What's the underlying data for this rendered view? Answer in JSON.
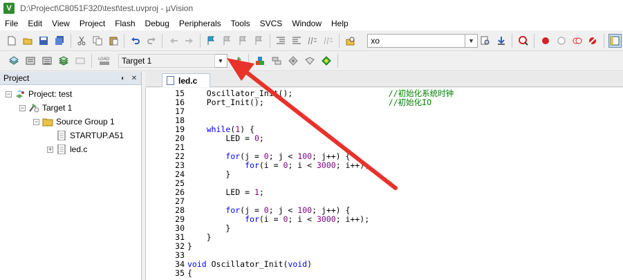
{
  "window": {
    "title": "D:\\Project\\C8051F320\\test\\test.uvproj - µVision",
    "icon_letter": "V"
  },
  "menu": [
    "File",
    "Edit",
    "View",
    "Project",
    "Flash",
    "Debug",
    "Peripherals",
    "Tools",
    "SVCS",
    "Window",
    "Help"
  ],
  "toolbar1": {
    "search_value": "xo"
  },
  "toolbar2": {
    "target_value": "Target 1"
  },
  "project_panel": {
    "title": "Project",
    "tree": [
      {
        "label": "Project: test",
        "expander": "−"
      },
      {
        "label": "Target 1",
        "expander": "−"
      },
      {
        "label": "Source Group 1",
        "expander": "−"
      },
      {
        "label": "STARTUP.A51",
        "expander": ""
      },
      {
        "label": "led.c",
        "expander": "+"
      }
    ]
  },
  "editor": {
    "tab_label": "led.c",
    "lines": [
      {
        "n": "15",
        "t": "    Oscillator_Init();                    //初始化系统时钟"
      },
      {
        "n": "16",
        "t": "    Port_Init();                          //初始化IO"
      },
      {
        "n": "17",
        "t": ""
      },
      {
        "n": "18",
        "t": ""
      },
      {
        "n": "19",
        "t": "    while(1) {"
      },
      {
        "n": "20",
        "t": "        LED = 0;"
      },
      {
        "n": "21",
        "t": ""
      },
      {
        "n": "22",
        "t": "        for(j = 0; j < 100; j++) {"
      },
      {
        "n": "23",
        "t": "            for(i = 0; i < 3000; i++);"
      },
      {
        "n": "24",
        "t": "        }"
      },
      {
        "n": "25",
        "t": ""
      },
      {
        "n": "26",
        "t": "        LED = 1;"
      },
      {
        "n": "27",
        "t": ""
      },
      {
        "n": "28",
        "t": "        for(j = 0; j < 100; j++) {"
      },
      {
        "n": "29",
        "t": "            for(i = 0; i < 3000; i++);"
      },
      {
        "n": "30",
        "t": "        }"
      },
      {
        "n": "31",
        "t": "    }"
      },
      {
        "n": "32",
        "t": "}"
      },
      {
        "n": "33",
        "t": ""
      },
      {
        "n": "34",
        "t": "void Oscillator_Init(void)"
      },
      {
        "n": "35",
        "t": "{"
      }
    ]
  },
  "colors": {
    "arrow": "#e8322a",
    "keyword": "#0000ff",
    "number": "#800080",
    "comment": "#008000"
  }
}
